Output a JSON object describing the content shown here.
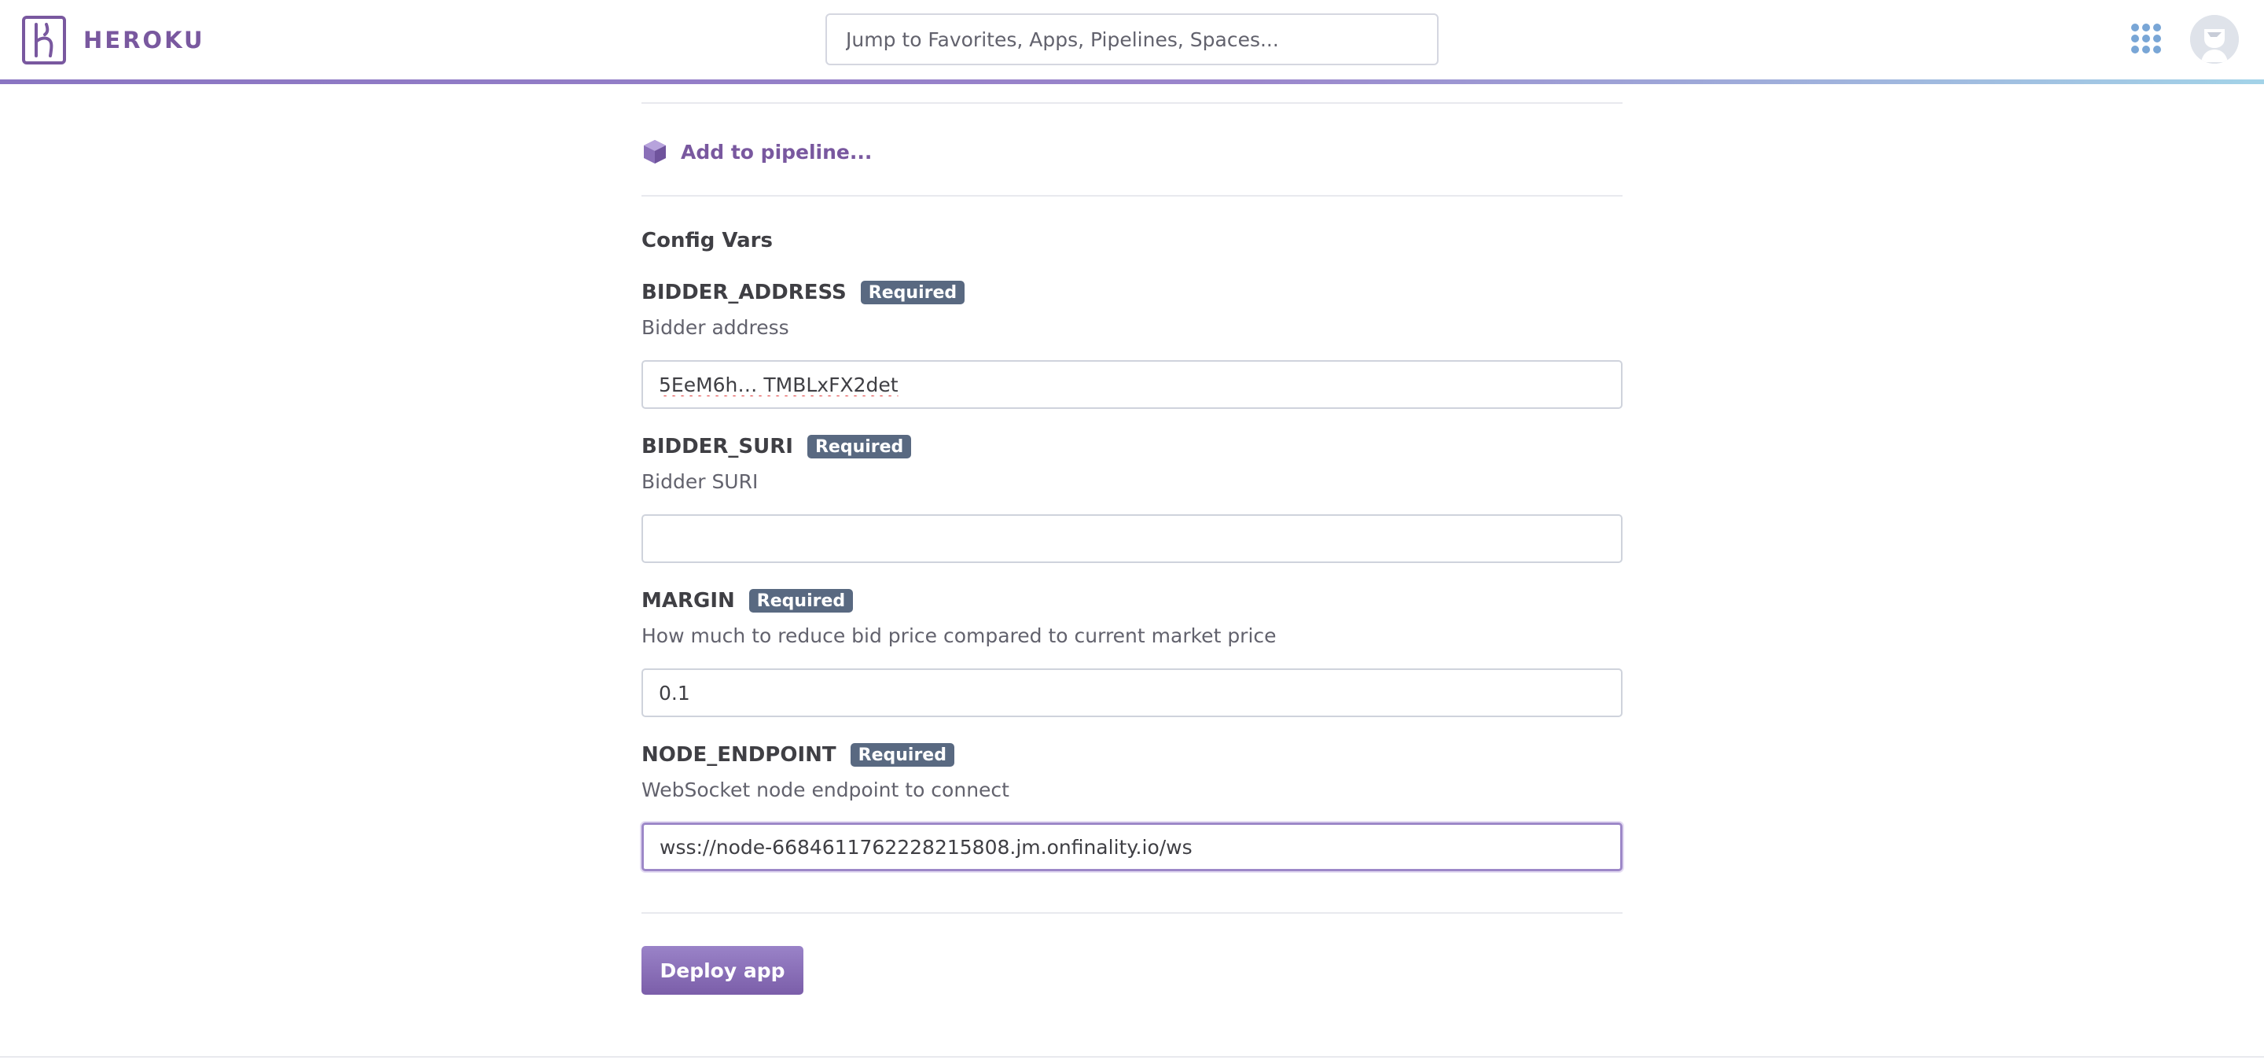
{
  "header": {
    "brand_name": "HEROKU",
    "search_placeholder": "Jump to Favorites, Apps, Pipelines, Spaces...",
    "accent_color": "#79589f"
  },
  "pipeline": {
    "label": "Add to pipeline..."
  },
  "config": {
    "title": "Config Vars",
    "fields": [
      {
        "name": "BIDDER_ADDRESS",
        "badge": "Required",
        "description": "Bidder address",
        "value": "5EeM6h… TMBLxFX2det"
      },
      {
        "name": "BIDDER_SURI",
        "badge": "Required",
        "description": "Bidder SURI",
        "value": ""
      },
      {
        "name": "MARGIN",
        "badge": "Required",
        "description": "How much to reduce bid price compared to current market price",
        "value": "0.1"
      },
      {
        "name": "NODE_ENDPOINT",
        "badge": "Required",
        "description": "WebSocket node endpoint to connect",
        "value": "wss://node-6684611762228215808.jm.onfinality.io/ws"
      }
    ]
  },
  "actions": {
    "deploy_label": "Deploy app"
  }
}
